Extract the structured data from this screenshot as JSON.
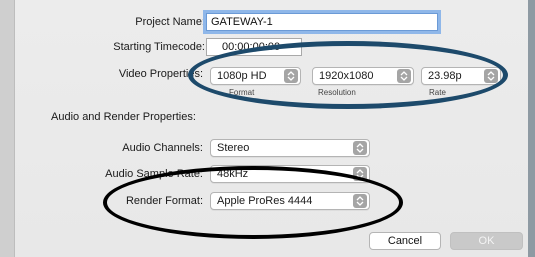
{
  "project": {
    "name_label": "Project Name:",
    "name_value": "GATEWAY-1",
    "timecode_label": "Starting Timecode:",
    "timecode_value": "00:00:00:00"
  },
  "video": {
    "label": "Video Properties:",
    "format_value": "1080p HD",
    "format_sublabel": "Format",
    "resolution_value": "1920x1080",
    "resolution_sublabel": "Resolution",
    "rate_value": "23.98p",
    "rate_sublabel": "Rate"
  },
  "audio_render": {
    "section_label": "Audio and Render Properties:",
    "channels_label": "Audio Channels:",
    "channels_value": "Stereo",
    "sample_rate_label": "Audio Sample Rate:",
    "sample_rate_value": "48kHz",
    "render_format_label": "Render Format:",
    "render_format_value": "Apple ProRes 4444"
  },
  "buttons": {
    "cancel": "Cancel",
    "ok": "OK"
  },
  "icons": {
    "stepper": "up-down-chevron-icon"
  },
  "colors": {
    "annotation_blue": "#1d4a6b",
    "annotation_black": "#000000",
    "focus_ring": "#8fb7e9"
  }
}
